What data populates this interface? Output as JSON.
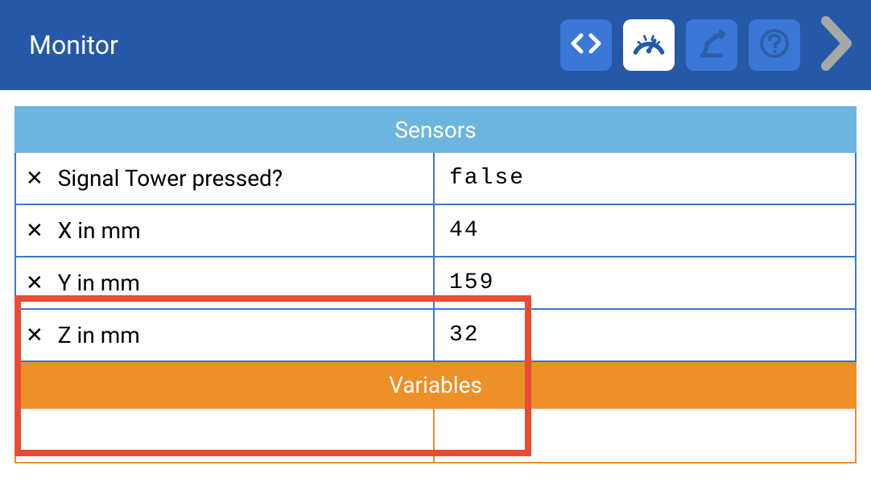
{
  "header": {
    "title": "Monitor"
  },
  "sections": {
    "sensors": {
      "title": "Sensors",
      "rows": [
        {
          "label": "Signal Tower pressed?",
          "value": "false"
        },
        {
          "label": "X in mm",
          "value": "44"
        },
        {
          "label": "Y in mm",
          "value": "159"
        },
        {
          "label": "Z in mm",
          "value": "32"
        }
      ]
    },
    "variables": {
      "title": "Variables"
    }
  },
  "icons": {
    "code": "code-icon",
    "gauge": "gauge-icon",
    "robot": "robot-icon",
    "help": "help-icon",
    "chevron": "chevron-right-icon"
  }
}
